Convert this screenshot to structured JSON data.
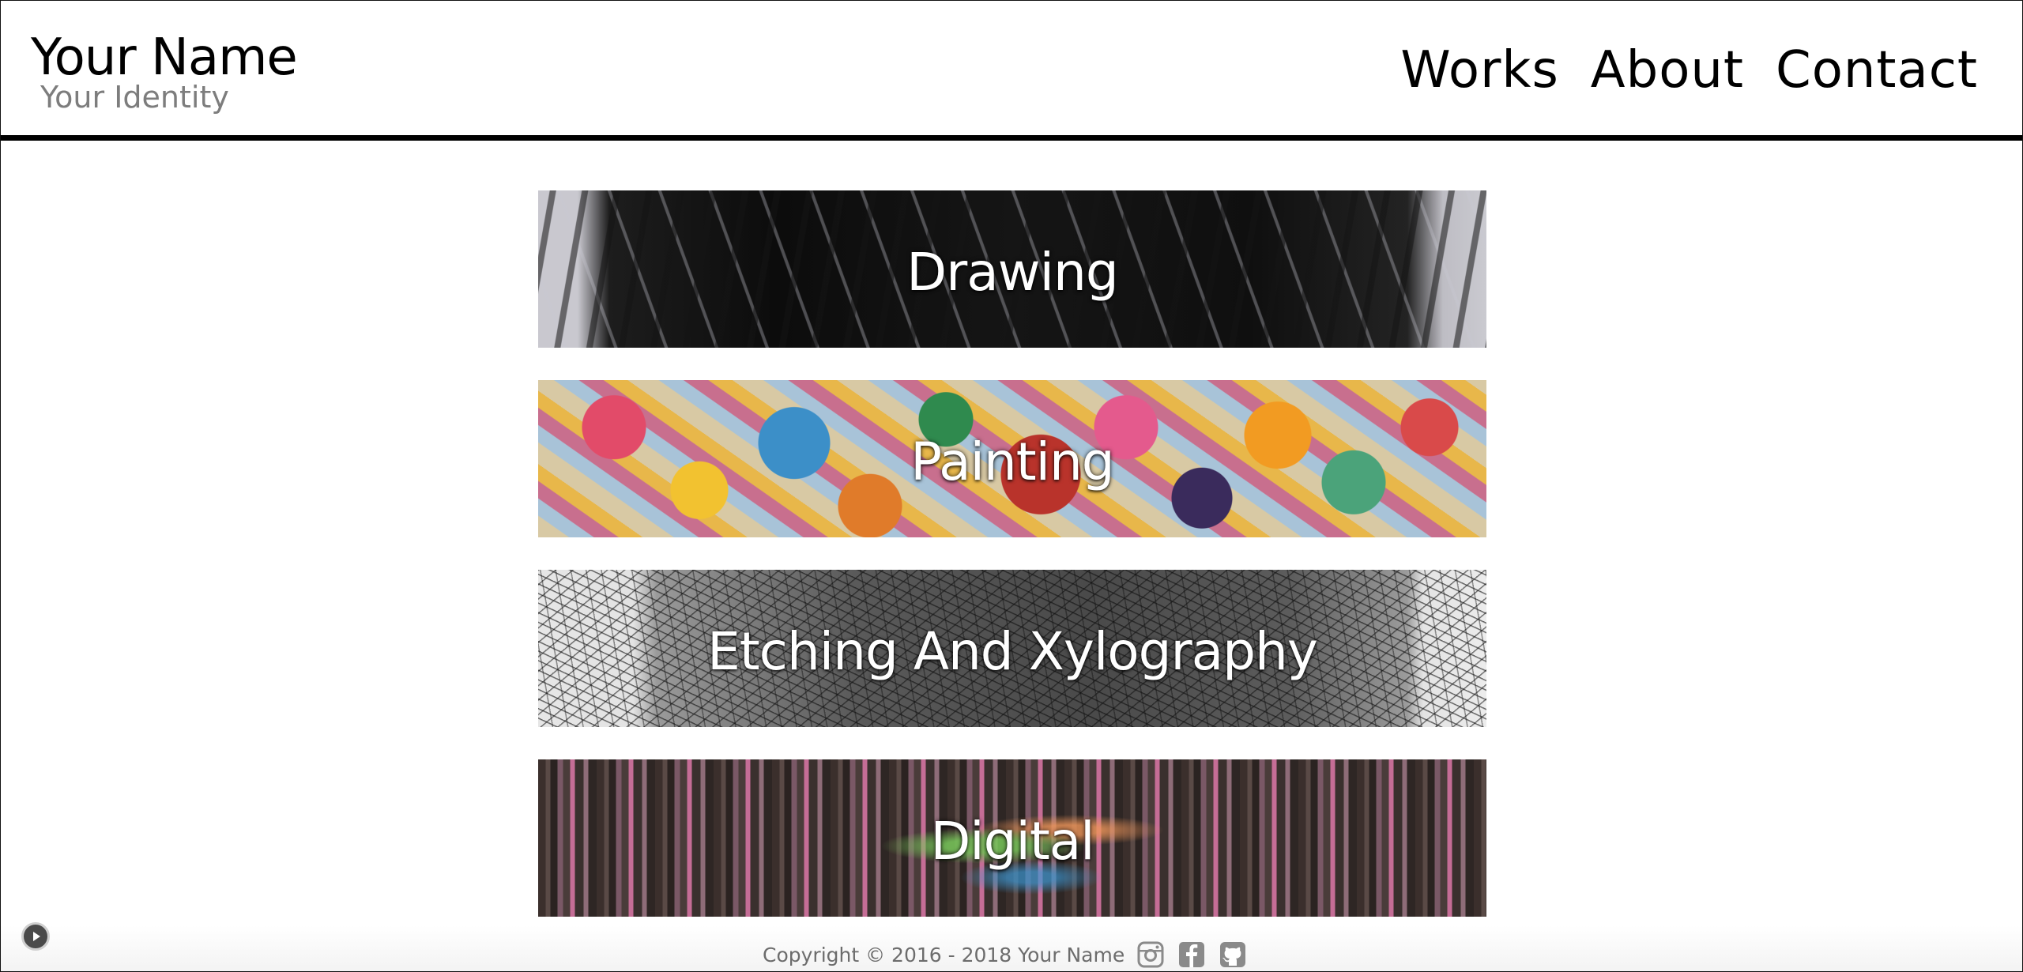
{
  "header": {
    "brand_name": "Your Name",
    "brand_identity": "Your Identity",
    "nav": [
      {
        "label": "Works"
      },
      {
        "label": "About"
      },
      {
        "label": "Contact"
      }
    ]
  },
  "categories": [
    {
      "label": "Drawing",
      "image": "drawing-artwork"
    },
    {
      "label": "Painting",
      "image": "painting-artwork"
    },
    {
      "label": "Etching And Xylography",
      "image": "etching-artwork"
    },
    {
      "label": "Digital",
      "image": "digital-artwork"
    }
  ],
  "footer": {
    "copyright": "Copyright © 2016 - 2018  Your Name",
    "social_icons": [
      "instagram-icon",
      "facebook-icon",
      "github-icon"
    ]
  },
  "colors": {
    "text": "#000000",
    "identity": "#7d7d7d",
    "footer_text": "#6c6c6c",
    "header_rule": "#000000"
  }
}
